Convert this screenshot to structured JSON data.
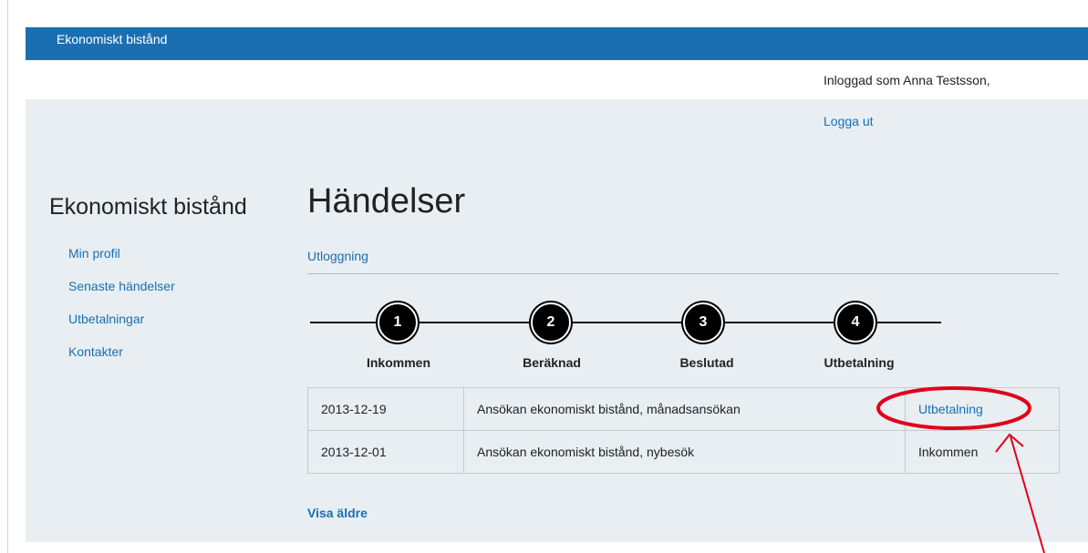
{
  "header": {
    "brand": "Ekonomiskt bistånd"
  },
  "user": {
    "logged_in_text": "Inloggad som Anna Testsson,",
    "logout_label": "Logga ut"
  },
  "sidebar": {
    "title": "Ekonomiskt bistånd",
    "items": [
      {
        "label": "Min profil"
      },
      {
        "label": "Senaste händelser"
      },
      {
        "label": "Utbetalningar"
      },
      {
        "label": "Kontakter"
      }
    ]
  },
  "main": {
    "title": "Händelser",
    "sub_link": "Utloggning",
    "steps": [
      {
        "number": "1",
        "label": "Inkommen"
      },
      {
        "number": "2",
        "label": "Beräknad"
      },
      {
        "number": "3",
        "label": "Beslutad"
      },
      {
        "number": "4",
        "label": "Utbetalning"
      }
    ],
    "events": [
      {
        "date": "2013-12-19",
        "description": "Ansökan ekonomiskt bistånd, månadsansökan",
        "status": "Utbetalning"
      },
      {
        "date": "2013-12-01",
        "description": "Ansökan ekonomiskt bistånd, nybesök",
        "status": "Inkommen"
      }
    ],
    "show_older_label": "Visa äldre"
  },
  "colors": {
    "accent": "#1a6fb3",
    "annotation": "#e0001b"
  }
}
